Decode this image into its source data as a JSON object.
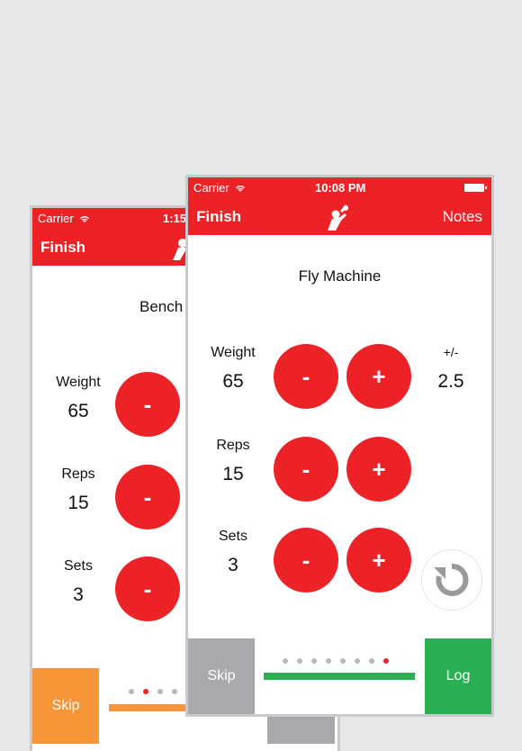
{
  "back_screen": {
    "status": {
      "carrier": "Carrier",
      "time": "1:15"
    },
    "nav": {
      "finish": "Finish",
      "logo_icon": "weightlifter-icon"
    },
    "exercise": "Bench",
    "fields": [
      {
        "label": "Weight",
        "value": "65",
        "minus": "-"
      },
      {
        "label": "Reps",
        "value": "15",
        "minus": "-"
      },
      {
        "label": "Sets",
        "value": "3",
        "minus": "-"
      }
    ],
    "bottom": {
      "skip": "Skip",
      "dots_total": 4,
      "active_dot": 2,
      "progress_fraction": 0.47
    },
    "colors": {
      "accent": "#ec2227",
      "skip_bg": "#f69437",
      "progress": "#f69437"
    }
  },
  "front_screen": {
    "status": {
      "carrier": "Carrier",
      "time": "10:08 PM",
      "wifi_icon": "wifi-icon",
      "battery_icon": "battery-icon"
    },
    "nav": {
      "finish": "Finish",
      "notes": "Notes",
      "logo_icon": "weightlifter-icon"
    },
    "exercise": "Fly Machine",
    "increment": {
      "label": "+/-",
      "value": "2.5"
    },
    "fields": [
      {
        "label": "Weight",
        "value": "65",
        "minus": "-",
        "plus": "+"
      },
      {
        "label": "Reps",
        "value": "15",
        "minus": "-",
        "plus": "+"
      },
      {
        "label": "Sets",
        "value": "3",
        "minus": "-",
        "plus": "+"
      }
    ],
    "reset_icon": "undo-icon",
    "bottom": {
      "skip": "Skip",
      "log": "Log",
      "dots_total": 8,
      "active_dot": 8,
      "progress_fraction": 1.0
    },
    "colors": {
      "accent": "#ec2227",
      "skip_bg": "#a7a9ac",
      "log_bg": "#2ab052",
      "progress": "#2ab052"
    }
  }
}
